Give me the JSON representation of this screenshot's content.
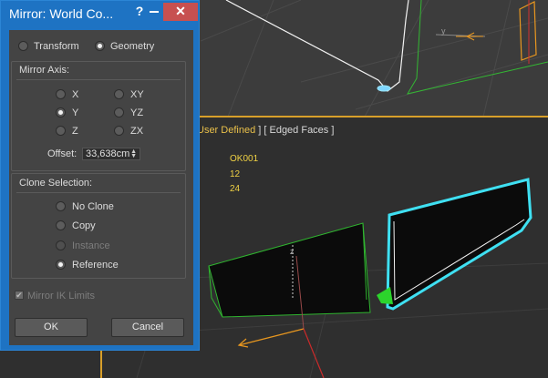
{
  "dialog": {
    "title": "Mirror: World Co...",
    "help": "?",
    "close": "✕",
    "mode": {
      "transform": "Transform",
      "geometry": "Geometry",
      "selected": "Geometry"
    },
    "mirror_axis": {
      "label": "Mirror Axis:",
      "options": [
        "X",
        "Y",
        "Z",
        "XY",
        "YZ",
        "ZX"
      ],
      "selected": "Y"
    },
    "offset": {
      "label": "Offset:",
      "value": "33,638cm"
    },
    "clone_selection": {
      "label": "Clone Selection:",
      "options": [
        "No Clone",
        "Copy",
        "Instance",
        "Reference"
      ],
      "selected": "Reference",
      "disabled": [
        "Instance"
      ]
    },
    "mirror_ik": {
      "label": "Mirror IK Limits",
      "checked": true,
      "disabled": true
    },
    "ok": "OK",
    "cancel": "Cancel"
  },
  "viewport": {
    "header_prefix": "User Defined",
    "header_suffix": " ] [ Edged Faces ]",
    "stats": [
      "OK001",
      "12",
      "24"
    ],
    "axis_label_top": "y",
    "axis_label_bottom": "z",
    "colors": {
      "selection": "#3fe0f2",
      "stats": "#f0d244",
      "active_border": "#d89f2a",
      "dialog": "#1e73c3"
    }
  }
}
